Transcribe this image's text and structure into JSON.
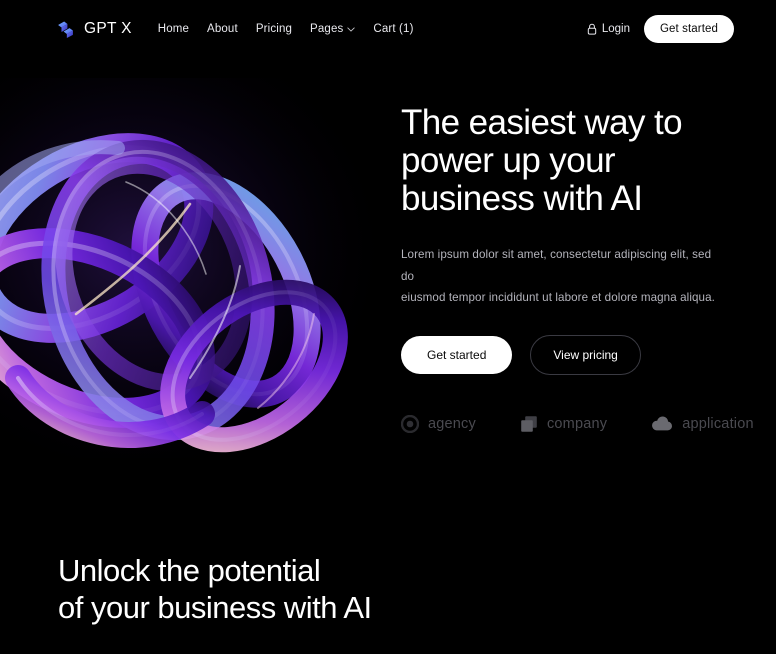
{
  "brand": {
    "name": "GPT X",
    "logo_icon": "blocks-logo-icon",
    "colors": {
      "start": "#5b8dfc",
      "mid": "#7b6ef6",
      "end": "#3c3fd6"
    }
  },
  "nav": {
    "links": [
      {
        "label": "Home",
        "has_chevron": false
      },
      {
        "label": "About",
        "has_chevron": false
      },
      {
        "label": "Pricing",
        "has_chevron": false
      },
      {
        "label": "Pages",
        "has_chevron": true
      },
      {
        "label": "Cart (1)",
        "has_chevron": false
      }
    ],
    "login": {
      "label": "Login",
      "icon": "lock-icon"
    },
    "cta": {
      "label": "Get started"
    }
  },
  "hero": {
    "title": "The easiest way to\npower up your\nbusiness with AI",
    "subtitle": "Lorem ipsum dolor sit amet, consectetur adipiscing elit, sed do\neiusmod tempor incididunt ut labore et dolore magna aliqua.",
    "primary_cta": "Get started",
    "secondary_cta": "View pricing",
    "artwork": {
      "name": "abstract-3d-rings-artwork",
      "colors": {
        "periwinkle": "#8f93e6",
        "sky": "#6fa8f0",
        "violet": "#7a33e0",
        "purple": "#5b1fc4",
        "magenta": "#c36ae8",
        "pink": "#f0b6d8",
        "deep": "#1b0b46"
      }
    },
    "partners": [
      {
        "label": "agency",
        "icon": "circle-logo-icon"
      },
      {
        "label": "company",
        "icon": "squares-logo-icon"
      },
      {
        "label": "application",
        "icon": "cloud-logo-icon"
      }
    ]
  },
  "bottom_section": {
    "title": "Unlock the potential\nof your business with AI"
  },
  "theme": {
    "background": "#000000",
    "text": "#ffffff",
    "muted": "#b4b4bc",
    "partner_text": "#4a4a50",
    "border": "#3a3a42"
  }
}
